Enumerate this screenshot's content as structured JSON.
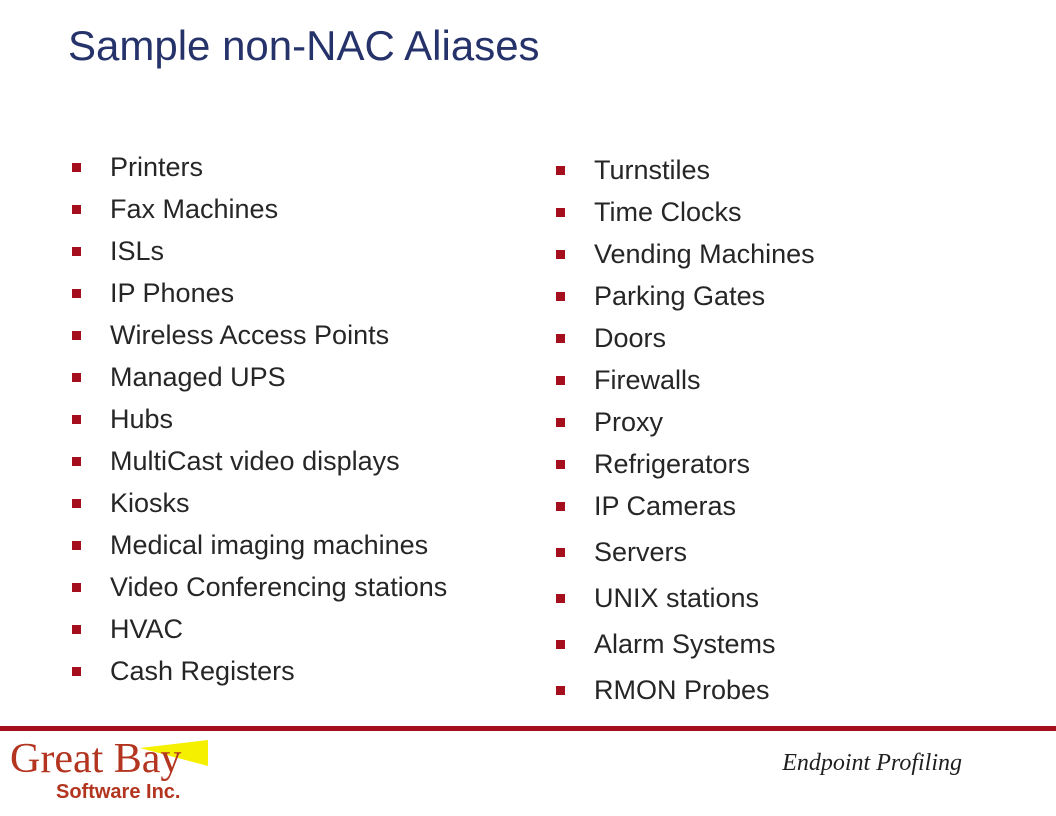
{
  "slide": {
    "title": "Sample non-NAC Aliases",
    "left_list": [
      "Printers",
      "Fax Machines",
      "ISLs",
      "IP Phones",
      "Wireless Access Points",
      "Managed UPS",
      "Hubs",
      "MultiCast video displays",
      "Kiosks",
      "Medical imaging machines",
      "Video Conferencing stations",
      "HVAC",
      "Cash Registers"
    ],
    "right_list": [
      "Turnstiles",
      "Time Clocks",
      "Vending Machines",
      "Parking Gates",
      "Doors",
      "Firewalls",
      "Proxy",
      "Refrigerators",
      "IP Cameras",
      "Servers",
      "UNIX stations",
      "Alarm Systems",
      "RMON Probes"
    ],
    "bullet_icon": "square-bullet-icon"
  },
  "footer": {
    "logo_main": "Great Bay",
    "logo_sub": "Software Inc.",
    "logo_beam_icon": "light-beam-icon",
    "caption": "Endpoint Profiling"
  },
  "colors": {
    "title": "#26336b",
    "bullet": "#a50e1c",
    "divider": "#a50e1c",
    "logo": "#b33520",
    "beam": "#f5f000"
  }
}
